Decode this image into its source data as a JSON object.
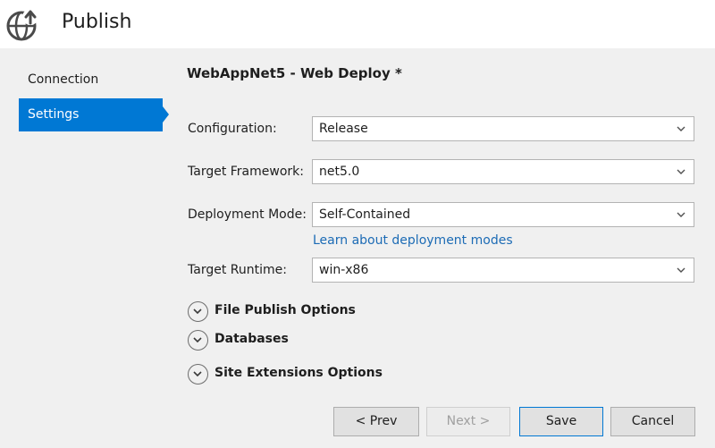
{
  "header": {
    "title": "Publish",
    "icon": "globe-publish-icon"
  },
  "sidebar": {
    "items": [
      {
        "label": "Connection",
        "selected": false
      },
      {
        "label": "Settings",
        "selected": true
      }
    ]
  },
  "profile": {
    "title": "WebAppNet5 - Web Deploy *"
  },
  "fields": {
    "configuration": {
      "label": "Configuration:",
      "value": "Release"
    },
    "target_framework": {
      "label": "Target Framework:",
      "value": "net5.0"
    },
    "deployment_mode": {
      "label": "Deployment Mode:",
      "value": "Self-Contained"
    },
    "target_runtime": {
      "label": "Target Runtime:",
      "value": "win-x86"
    }
  },
  "links": {
    "deployment_modes": "Learn about deployment modes"
  },
  "expanders": {
    "file_publish": "File Publish Options",
    "databases": "Databases",
    "site_extensions": "Site Extensions Options"
  },
  "buttons": {
    "prev": "< Prev",
    "next": "Next >",
    "save": "Save",
    "cancel": "Cancel"
  },
  "colors": {
    "accent": "#0078d4",
    "link": "#1c6bb5",
    "background": "#f0f0f0"
  }
}
